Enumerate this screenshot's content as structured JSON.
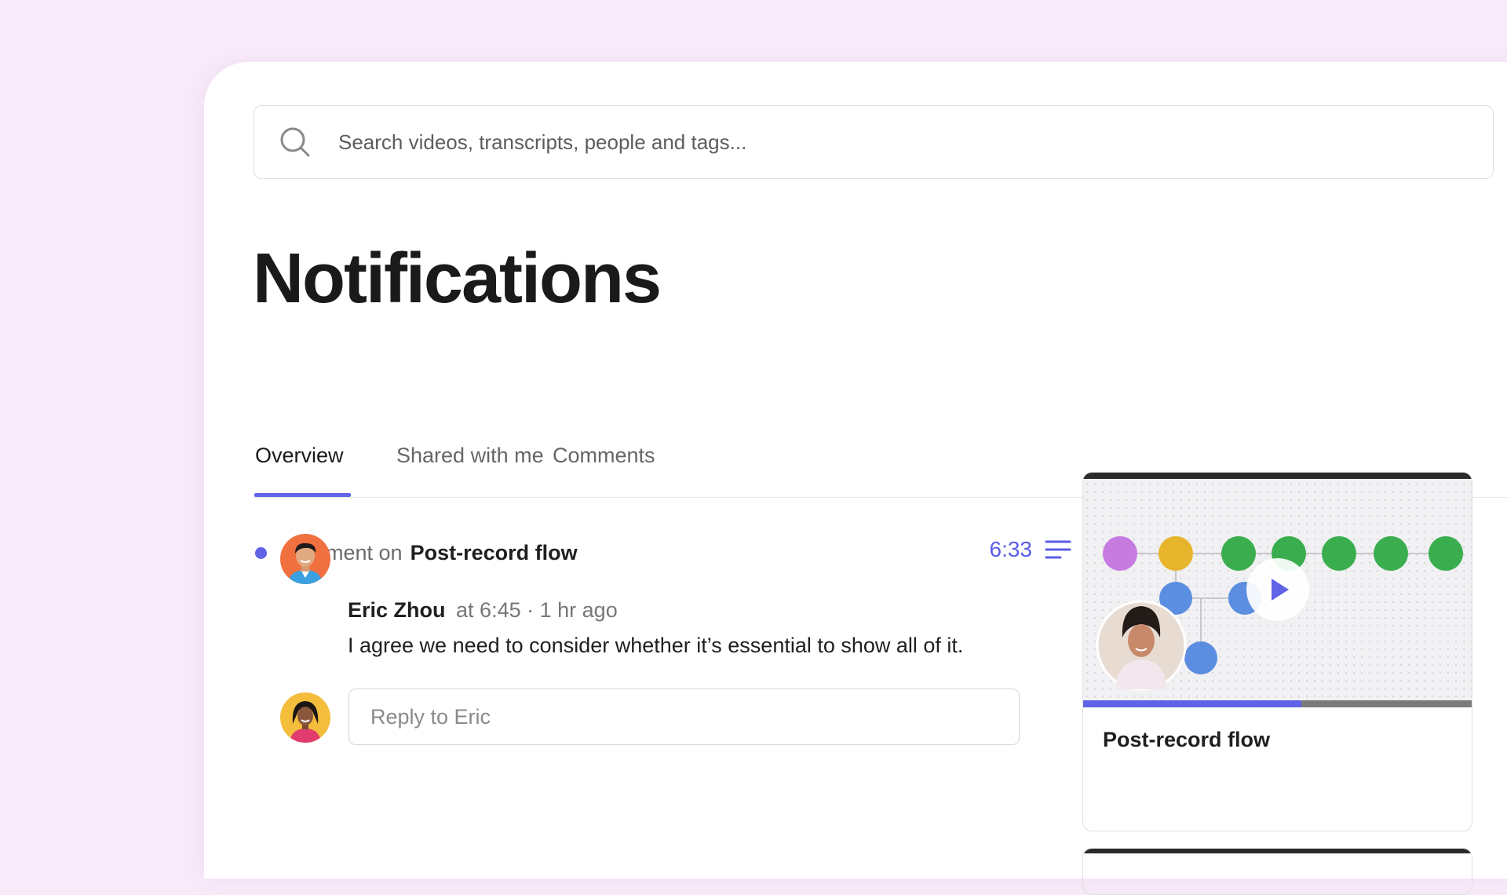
{
  "search": {
    "placeholder": "Search videos, transcripts, people and tags...",
    "icon": "search-icon"
  },
  "page": {
    "title": "Notifications"
  },
  "tabs": [
    {
      "label": "Overview",
      "active": true
    },
    {
      "label": "Shared with me",
      "active": false
    },
    {
      "label": "Comments",
      "active": false
    }
  ],
  "notification": {
    "kind": "Comment on",
    "video_title": "Post-record flow",
    "timestamp": "6:33",
    "timestamp_icon": "transcript-lines-icon",
    "comment": {
      "author": "Eric Zhou",
      "at": "at 6:45",
      "separator": "·",
      "age": "1 hr ago",
      "body": "I agree we need to consider whether it’s essential to show all of it."
    },
    "reply": {
      "placeholder": "Reply to Eric"
    }
  },
  "video_card": {
    "title": "Post-record flow",
    "progress": 0.56,
    "play_icon": "play-icon"
  },
  "colors": {
    "accent": "#6063e6",
    "background": "#f8eaf9",
    "node_purple": "#c77be0",
    "node_yellow": "#e7b52c",
    "node_green": "#3aae4e",
    "node_blue": "#5b8de0"
  }
}
